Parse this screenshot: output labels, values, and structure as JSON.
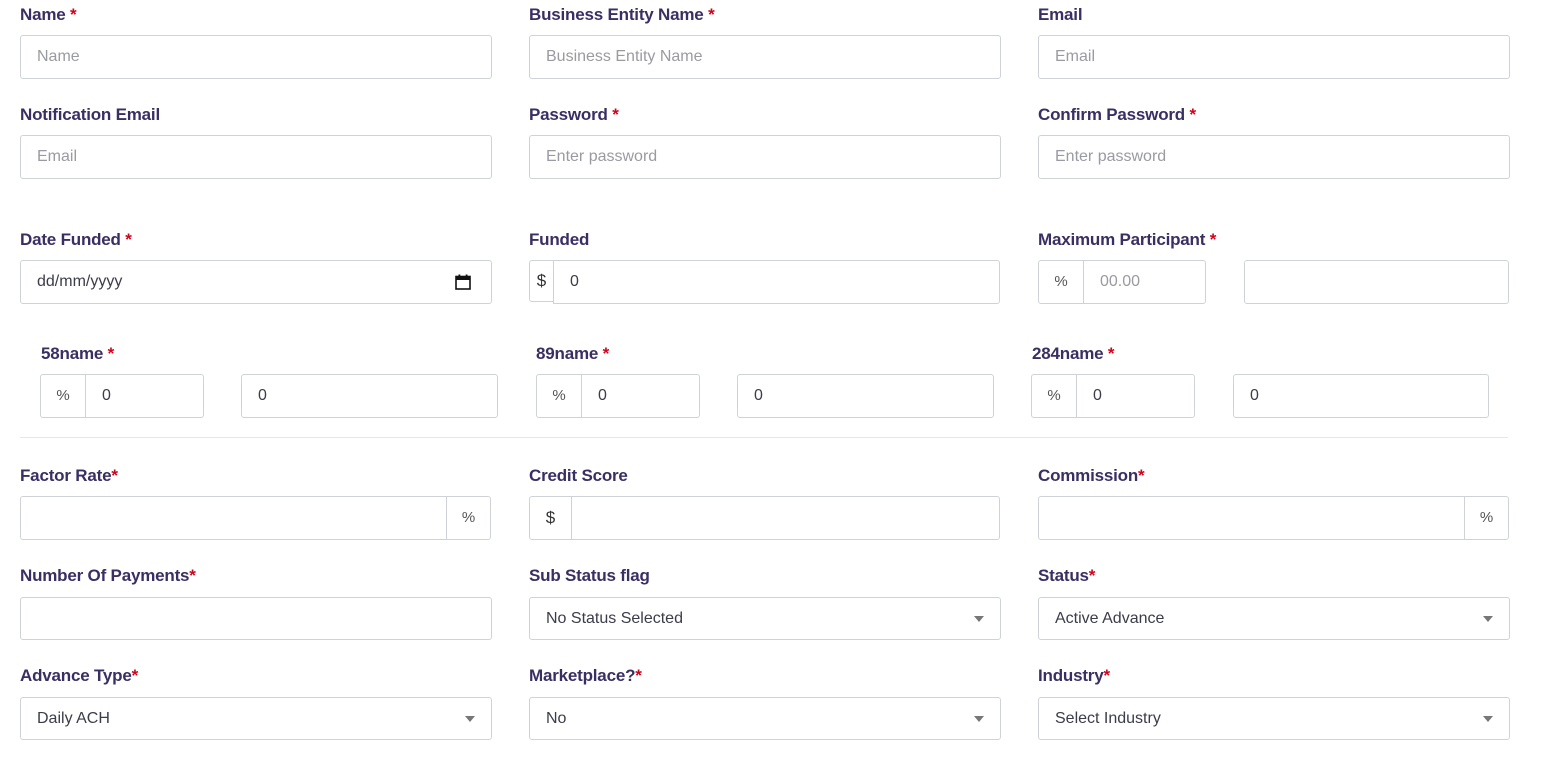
{
  "row1": {
    "name": {
      "label": "Name",
      "req": "*",
      "placeholder": "Name"
    },
    "business": {
      "label": "Business Entity Name",
      "req": "*",
      "placeholder": "Business Entity Name"
    },
    "email": {
      "label": "Email",
      "placeholder": "Email"
    }
  },
  "row2": {
    "notification": {
      "label": "Notification Email",
      "placeholder": "Email"
    },
    "password": {
      "label": "Password",
      "req": "*",
      "placeholder": "Enter password"
    },
    "confirm": {
      "label": "Confirm Password",
      "req": "*",
      "placeholder": "Enter password"
    }
  },
  "row3": {
    "date": {
      "label": "Date Funded",
      "req": "*",
      "placeholder": "dd/mm/yyyy"
    },
    "funded": {
      "label": "Funded",
      "prefix": "$",
      "value": "0"
    },
    "maxpart": {
      "label": "Maximum Participant",
      "req": "*",
      "prefix": "%",
      "placeholder": "00.00",
      "value2": ""
    }
  },
  "participants": [
    {
      "label": "58name",
      "req": "*",
      "prefix": "%",
      "pct": "0",
      "amount": "0"
    },
    {
      "label": "89name",
      "req": "*",
      "prefix": "%",
      "pct": "0",
      "amount": "0"
    },
    {
      "label": "284name",
      "req": "*",
      "prefix": "%",
      "pct": "0",
      "amount": "0"
    }
  ],
  "row5": {
    "factor": {
      "label": "Factor Rate",
      "req": "*",
      "suffix": "%",
      "value": ""
    },
    "credit": {
      "label": "Credit Score",
      "prefix": "$",
      "value": ""
    },
    "commission": {
      "label": "Commission",
      "req": "*",
      "suffix": "%",
      "value": ""
    }
  },
  "row6": {
    "payments": {
      "label": "Number Of Payments",
      "req": "*",
      "value": ""
    },
    "substatus": {
      "label": "Sub Status flag",
      "selected": "No Status Selected"
    },
    "status": {
      "label": "Status",
      "req": "*",
      "selected": "Active Advance"
    }
  },
  "row7": {
    "advtype": {
      "label": "Advance Type",
      "req": "*",
      "selected": "Daily ACH"
    },
    "marketplace": {
      "label": "Marketplace?",
      "req": "*",
      "selected": "No"
    },
    "industry": {
      "label": "Industry",
      "req": "*",
      "selected": "Select Industry"
    }
  },
  "icons": {
    "calendar": "calendar-icon",
    "dropdown": "chevron-down-icon"
  }
}
